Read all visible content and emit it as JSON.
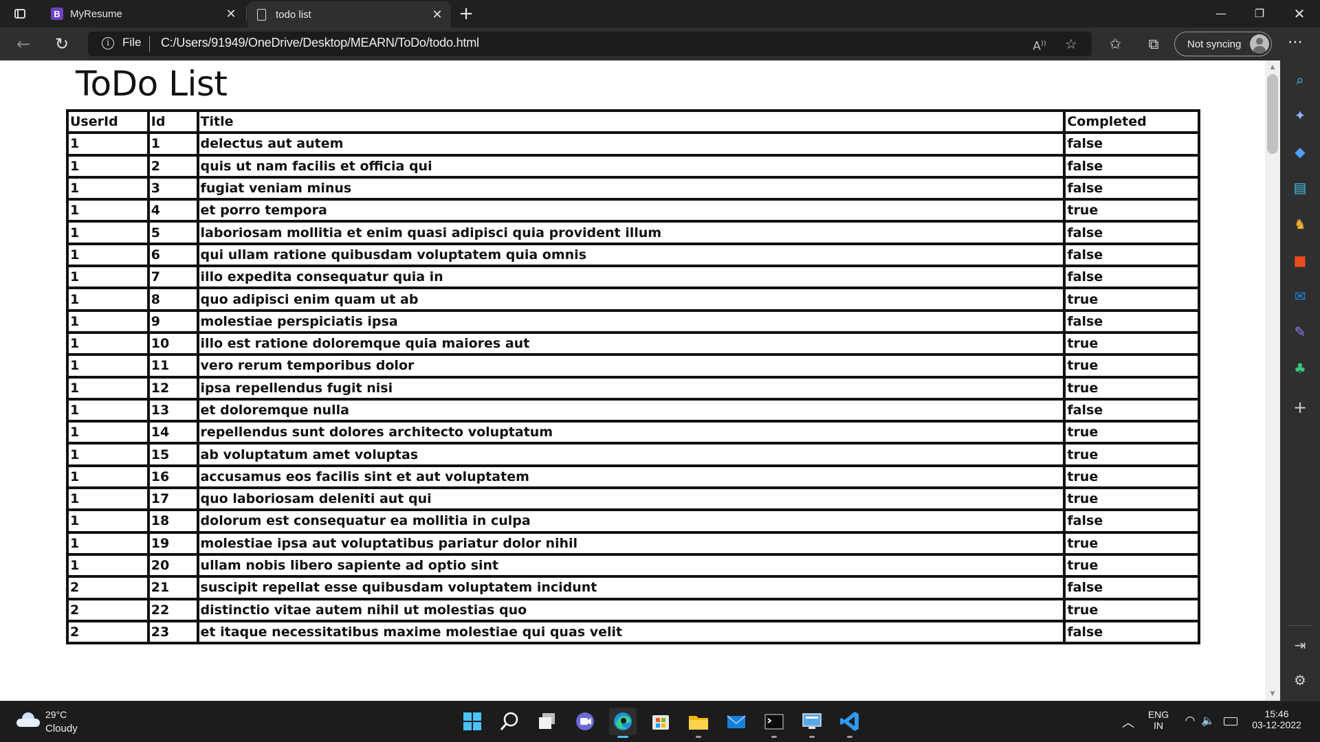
{
  "browser": {
    "tabs": [
      {
        "favicon_letter": "B",
        "title": "MyResume",
        "active": false
      },
      {
        "title": "todo list",
        "active": true
      }
    ],
    "address_bar": {
      "scheme_label": "File",
      "url": "C:/Users/91949/OneDrive/Desktop/MEARN/ToDo/todo.html"
    },
    "profile_button_label": "Not syncing"
  },
  "page": {
    "heading": "ToDo List",
    "table": {
      "headers": [
        "UserId",
        "Id",
        "Title",
        "Completed"
      ],
      "rows": [
        [
          "1",
          "1",
          "delectus aut autem",
          "false"
        ],
        [
          "1",
          "2",
          "quis ut nam facilis et officia qui",
          "false"
        ],
        [
          "1",
          "3",
          "fugiat veniam minus",
          "false"
        ],
        [
          "1",
          "4",
          "et porro tempora",
          "true"
        ],
        [
          "1",
          "5",
          "laboriosam mollitia et enim quasi adipisci quia provident illum",
          "false"
        ],
        [
          "1",
          "6",
          "qui ullam ratione quibusdam voluptatem quia omnis",
          "false"
        ],
        [
          "1",
          "7",
          "illo expedita consequatur quia in",
          "false"
        ],
        [
          "1",
          "8",
          "quo adipisci enim quam ut ab",
          "true"
        ],
        [
          "1",
          "9",
          "molestiae perspiciatis ipsa",
          "false"
        ],
        [
          "1",
          "10",
          "illo est ratione doloremque quia maiores aut",
          "true"
        ],
        [
          "1",
          "11",
          "vero rerum temporibus dolor",
          "true"
        ],
        [
          "1",
          "12",
          "ipsa repellendus fugit nisi",
          "true"
        ],
        [
          "1",
          "13",
          "et doloremque nulla",
          "false"
        ],
        [
          "1",
          "14",
          "repellendus sunt dolores architecto voluptatum",
          "true"
        ],
        [
          "1",
          "15",
          "ab voluptatum amet voluptas",
          "true"
        ],
        [
          "1",
          "16",
          "accusamus eos facilis sint et aut voluptatem",
          "true"
        ],
        [
          "1",
          "17",
          "quo laboriosam deleniti aut qui",
          "true"
        ],
        [
          "1",
          "18",
          "dolorum est consequatur ea mollitia in culpa",
          "false"
        ],
        [
          "1",
          "19",
          "molestiae ipsa aut voluptatibus pariatur dolor nihil",
          "true"
        ],
        [
          "1",
          "20",
          "ullam nobis libero sapiente ad optio sint",
          "true"
        ],
        [
          "2",
          "21",
          "suscipit repellat esse quibusdam voluptatem incidunt",
          "false"
        ],
        [
          "2",
          "22",
          "distinctio vitae autem nihil ut molestias quo",
          "true"
        ],
        [
          "2",
          "23",
          "et itaque necessitatibus maxime molestiae qui quas velit",
          "false"
        ]
      ]
    }
  },
  "taskbar": {
    "weather": {
      "temp": "29°C",
      "condition": "Cloudy"
    },
    "apps": [
      "start-icon",
      "search-icon",
      "task-view-icon",
      "chat-icon",
      "edge-icon",
      "store-icon",
      "file-explorer-icon",
      "mail-icon",
      "terminal-icon",
      "remote-desktop-icon",
      "vscode-icon"
    ],
    "language": {
      "line1": "ENG",
      "line2": "IN"
    },
    "clock": {
      "time": "15:46",
      "date": "03-12-2022"
    }
  },
  "colors": {
    "chrome_dark": "#202020",
    "toolbar": "#2f2f2f",
    "page_bg": "#ffffff",
    "table_border": "#111111",
    "taskbar_active": "#4cc2ff"
  }
}
